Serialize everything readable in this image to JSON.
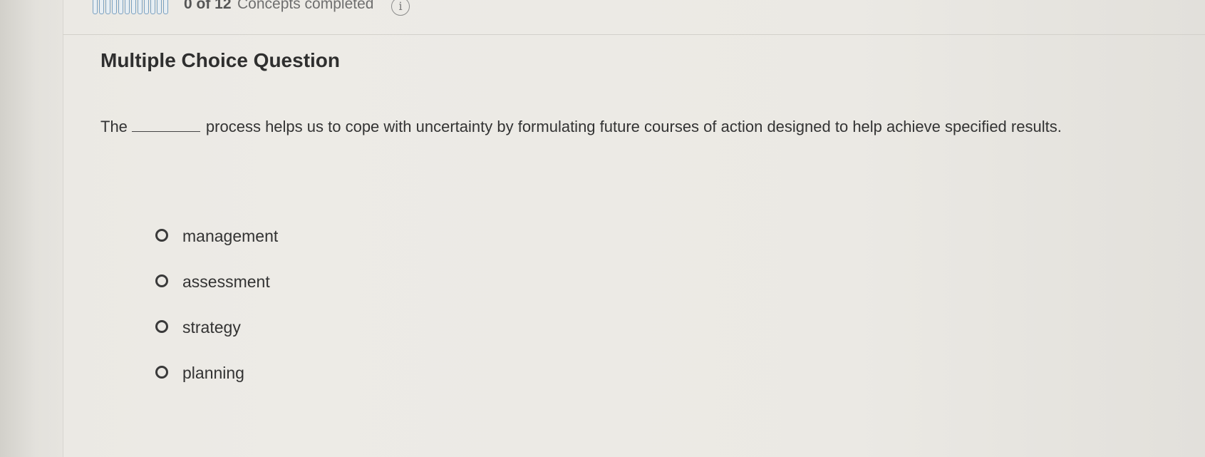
{
  "progress": {
    "segments_total": 12,
    "segments_completed": 0,
    "count_text": "0 of 12",
    "label": "Concepts completed",
    "info_icon": "info-icon"
  },
  "question": {
    "type_label": "Multiple Choice Question",
    "prompt_before": "The",
    "prompt_after": "process helps us to cope with uncertainty by formulating future courses of action designed to help achieve specified results.",
    "choices": [
      {
        "label": "management"
      },
      {
        "label": "assessment"
      },
      {
        "label": "strategy"
      },
      {
        "label": "planning"
      }
    ]
  }
}
